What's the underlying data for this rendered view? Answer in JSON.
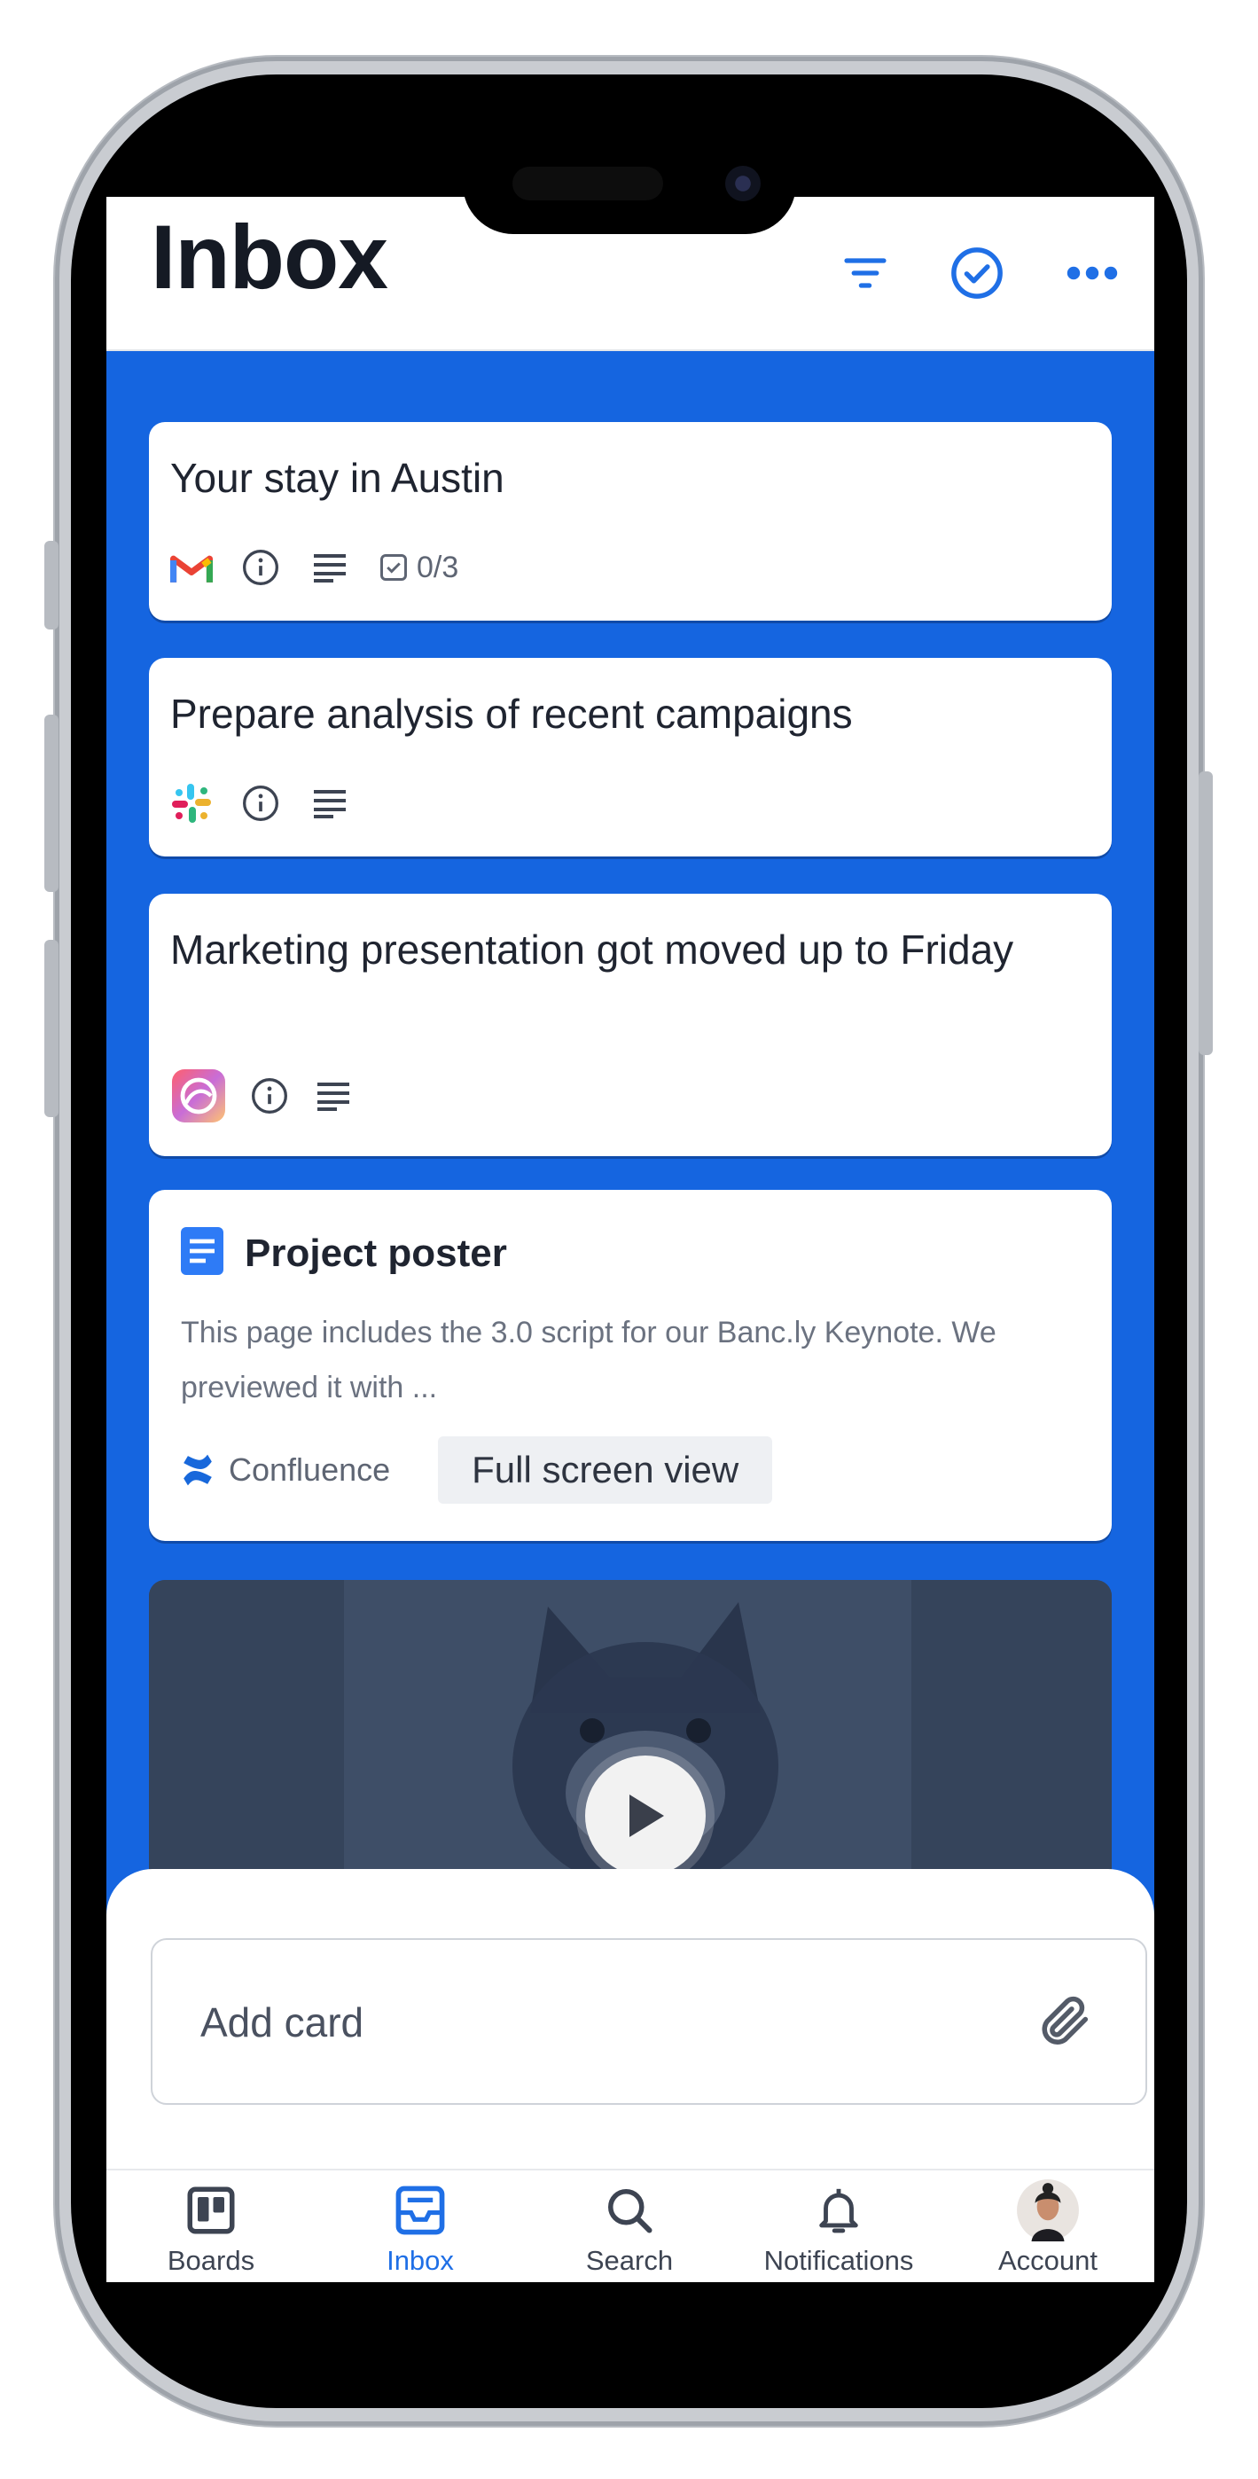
{
  "header": {
    "title": "Inbox",
    "icons": [
      "filter-icon",
      "check-circle-icon",
      "more-icon"
    ]
  },
  "cards": [
    {
      "title": "Your stay in Austin",
      "source_icon": "gmail-icon",
      "checklist": "0/3"
    },
    {
      "title": "Prepare analysis of recent campaigns",
      "source_icon": "slack-icon"
    },
    {
      "title": "Marketing presentation got moved up to Friday",
      "source_icon": "app-icon"
    }
  ],
  "doc_card": {
    "title": "Project poster",
    "excerpt": "This page includes the 3.0 script for our Banc.ly Keynote. We previewed it with ...",
    "source": "Confluence",
    "action": "Full screen view"
  },
  "composer": {
    "placeholder": "Add card"
  },
  "tabs": [
    {
      "label": "Boards",
      "icon": "boards-icon"
    },
    {
      "label": "Inbox",
      "icon": "inbox-icon",
      "active": true
    },
    {
      "label": "Search",
      "icon": "search-icon"
    },
    {
      "label": "Notifications",
      "icon": "bell-icon"
    },
    {
      "label": "Account",
      "icon": "avatar"
    }
  ],
  "colors": {
    "accent": "#1565e0",
    "active_tab": "#1f6fe6",
    "title": "#151a24"
  }
}
